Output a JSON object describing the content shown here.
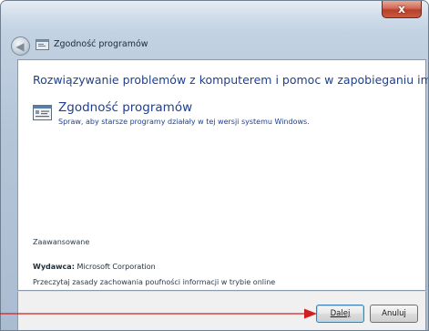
{
  "window": {
    "title": "Zgodność programów",
    "close_label": "x",
    "back_label": "◀"
  },
  "content": {
    "heading": "Rozwiązywanie problemów z komputerem i pomoc w zapobieganiu im",
    "option_title": "Zgodność programów",
    "option_description": "Spraw, aby starsze programy działały w tej wersji systemu Windows.",
    "advanced_label": "Zaawansowane",
    "publisher_label": "Wydawca:",
    "publisher_value": "Microsoft Corporation",
    "privacy_link": "Przeczytaj zasady zachowania poufności informacji w trybie online"
  },
  "footer": {
    "next_label": "Dalej",
    "cancel_label": "Anuluj"
  },
  "colors": {
    "link_blue": "#1f3f8f",
    "arrow_red": "#d21e1e",
    "frame": "#b4c5d8"
  },
  "icons": {
    "back": "back-arrow-icon",
    "title": "program-compatibility-icon",
    "option": "program-compatibility-icon",
    "close": "close-icon"
  }
}
